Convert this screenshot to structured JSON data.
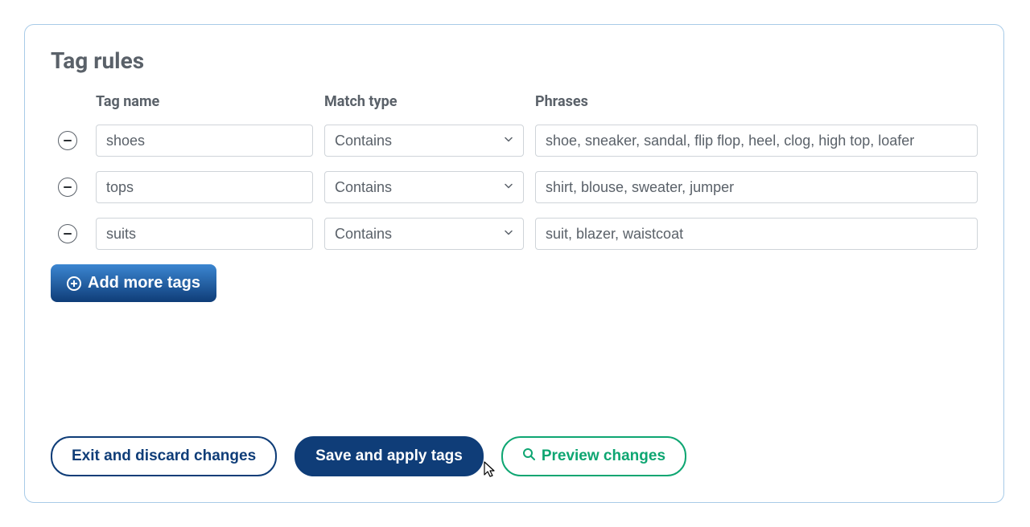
{
  "panel": {
    "title": "Tag rules"
  },
  "headers": {
    "tag_name": "Tag name",
    "match_type": "Match type",
    "phrases": "Phrases"
  },
  "rules": [
    {
      "tag_name": "shoes",
      "match_type": "Contains",
      "phrases": "shoe, sneaker, sandal, flip flop, heel, clog, high top, loafer"
    },
    {
      "tag_name": "tops",
      "match_type": "Contains",
      "phrases": "shirt, blouse, sweater, jumper"
    },
    {
      "tag_name": "suits",
      "match_type": "Contains",
      "phrases": "suit, blazer, waistcoat"
    }
  ],
  "buttons": {
    "add_more": "Add more tags",
    "exit": "Exit and discard changes",
    "save": "Save and apply tags",
    "preview": "Preview changes"
  }
}
